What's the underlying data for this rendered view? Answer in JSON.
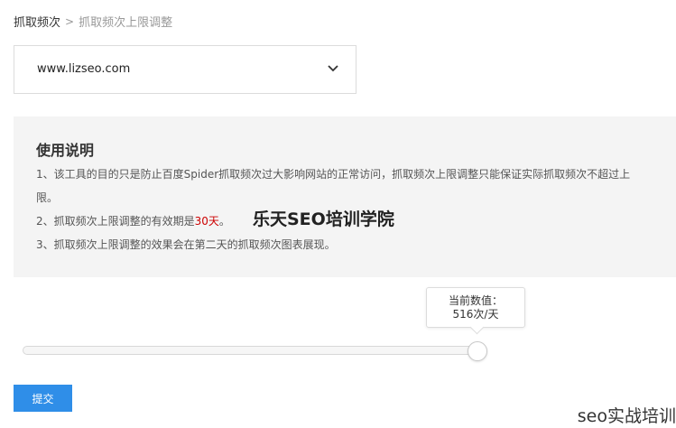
{
  "breadcrumb": {
    "parent": "抓取频次",
    "separator": ">",
    "current": "抓取频次上限调整"
  },
  "site_select": {
    "value": "www.lizseo.com"
  },
  "instructions": {
    "title": "使用说明",
    "line1a": "1、该工具的目的只是防止百度Spider抓取频次过大影响网站的正常访问，抓取频次上限调整只能保证实际抓取频次不超过上",
    "line1b": "限。",
    "line2_prefix": "2、抓取频次上限调整的有效期是",
    "line2_highlight": "30天",
    "line2_suffix": "。",
    "line3": "3、抓取频次上限调整的效果会在第二天的抓取频次图表展现。"
  },
  "watermark": "乐天SEO培训学院",
  "slider": {
    "tooltip_label": "当前数值：",
    "tooltip_value": "516次/天",
    "value": 516,
    "fill_fraction": 0.98
  },
  "submit_label": "提交",
  "corner_watermark": "seo实战培训",
  "colors": {
    "primary": "#2f8ee8",
    "highlight": "#cc0000",
    "panel_bg": "#f4f4f4"
  }
}
